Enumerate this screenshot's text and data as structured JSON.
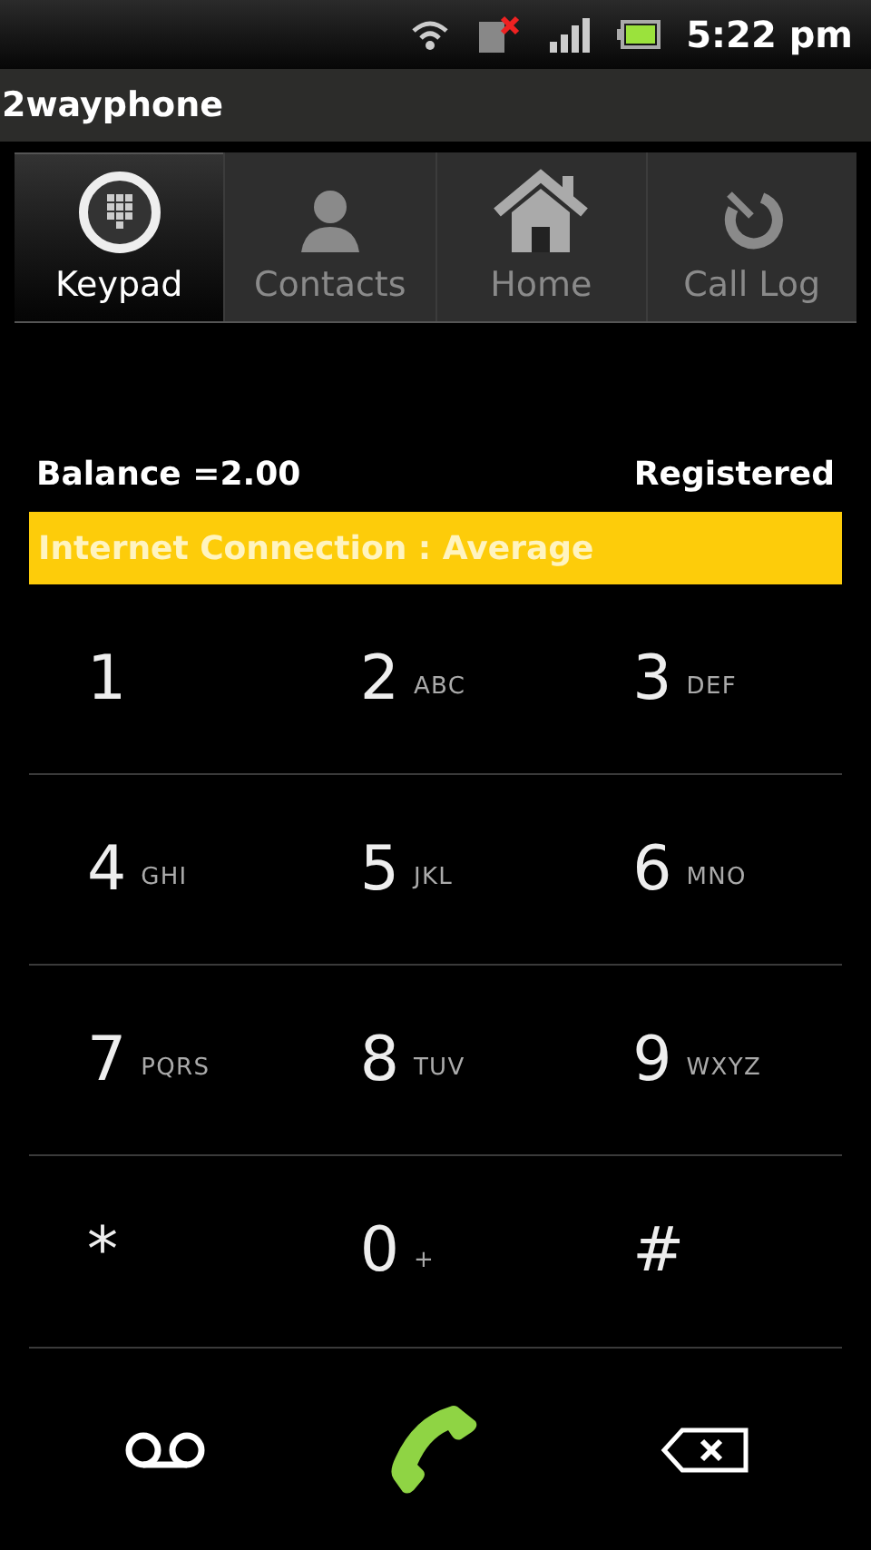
{
  "status_bar": {
    "time": "5:22 pm"
  },
  "app_title": "2wayphone",
  "tabs": [
    {
      "label": "Keypad",
      "selected": true
    },
    {
      "label": "Contacts",
      "selected": false
    },
    {
      "label": "Home",
      "selected": false
    },
    {
      "label": "Call Log",
      "selected": false
    }
  ],
  "balance": "Balance =2.00",
  "registration": "Registered",
  "connection_banner": "Internet Connection : Average",
  "keys": [
    {
      "digit": "1"
    },
    {
      "digit": "2",
      "letters": "ABC"
    },
    {
      "digit": "3",
      "letters": "DEF"
    },
    {
      "digit": "4",
      "letters": "GHI"
    },
    {
      "digit": "5",
      "letters": "JKL"
    },
    {
      "digit": "6",
      "letters": "MNO"
    },
    {
      "digit": "7",
      "letters": "PQRS"
    },
    {
      "digit": "8",
      "letters": "TUV"
    },
    {
      "digit": "9",
      "letters": "WXYZ"
    },
    {
      "digit": "*"
    },
    {
      "digit": "0",
      "letters": "+"
    },
    {
      "digit": "#"
    }
  ]
}
